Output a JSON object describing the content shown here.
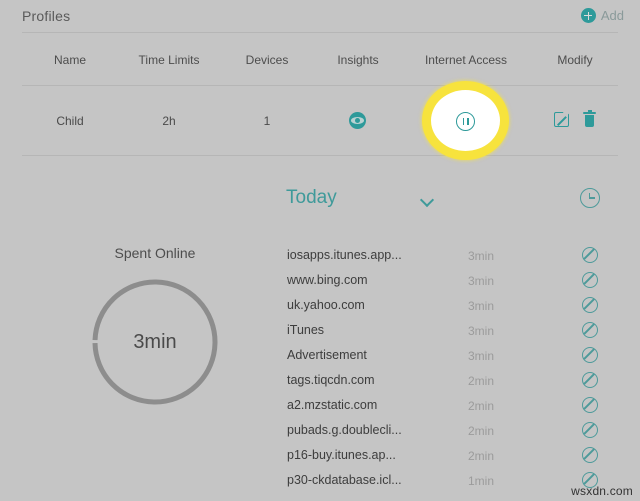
{
  "panel": {
    "title": "Profiles",
    "add_label": "Add",
    "add_icon": "plus-circle-icon"
  },
  "table": {
    "columns": [
      "Name",
      "Time Limits",
      "Devices",
      "Insights",
      "Internet Access",
      "Modify"
    ],
    "row": {
      "name": "Child",
      "time_limits": "2h",
      "devices": "1",
      "insights_icon": "eye-icon",
      "internet_access_icon": "pause-icon",
      "modify_icons": [
        "edit-icon",
        "trash-icon"
      ]
    },
    "highlight": {
      "target": "internet-access-pause-button",
      "ring_color": "#f7e33d"
    }
  },
  "toolbar": {
    "period_label": "Today",
    "period_chevron": "chevron-down-icon",
    "history_icon": "clock-icon"
  },
  "spent_online": {
    "title": "Spent Online",
    "value": "3min",
    "ring_color": "#8d8d8d"
  },
  "sites": {
    "items": [
      {
        "name": "iosapps.itunes.app...",
        "time": "3min",
        "action_icon": "block-icon"
      },
      {
        "name": "www.bing.com",
        "time": "3min",
        "action_icon": "block-icon"
      },
      {
        "name": "uk.yahoo.com",
        "time": "3min",
        "action_icon": "block-icon"
      },
      {
        "name": "iTunes",
        "time": "3min",
        "action_icon": "block-icon"
      },
      {
        "name": "Advertisement",
        "time": "3min",
        "action_icon": "block-icon"
      },
      {
        "name": "tags.tiqcdn.com",
        "time": "2min",
        "action_icon": "block-icon"
      },
      {
        "name": "a2.mzstatic.com",
        "time": "2min",
        "action_icon": "block-icon"
      },
      {
        "name": "pubads.g.doublecli...",
        "time": "2min",
        "action_icon": "block-icon"
      },
      {
        "name": "p16-buy.itunes.ap...",
        "time": "2min",
        "action_icon": "block-icon"
      },
      {
        "name": "p30-ckdatabase.icl...",
        "time": "1min",
        "action_icon": "block-icon"
      }
    ]
  },
  "watermark": "wsxdn.com",
  "colors": {
    "background": "#c5c5c5",
    "accent_teal": "#2e9a9a",
    "highlight_yellow": "#f7e33d",
    "text_dark": "#4a4a4a",
    "text_muted": "#9b9b9b"
  }
}
